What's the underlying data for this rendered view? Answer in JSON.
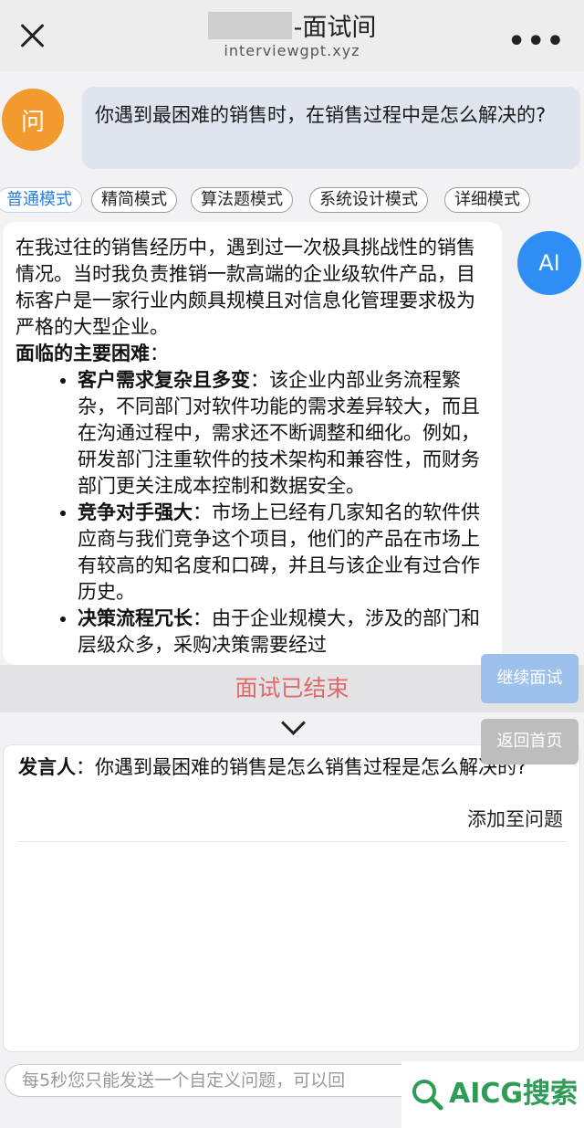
{
  "header": {
    "title": "-面试间",
    "url": "interviewgpt.xyz"
  },
  "question": {
    "avatar_label": "问",
    "text": "你遇到最困难的销售时，在销售过程中是怎么解决的?"
  },
  "modes": [
    "普通模式",
    "精简模式",
    "算法题模式",
    "系统设计模式",
    "详细模式"
  ],
  "answer": {
    "avatar_label": "AI",
    "intro": "在我过往的销售经历中，遇到过一次极具挑战性的销售情况。当时我负责推销一款高端的企业级软件产品，目标客户是一家行业内颇具规模且对信息化管理要求极为严格的大型企业。",
    "heading": "面临的主要困难",
    "heading_colon": "：",
    "points": [
      {
        "title": "客户需求复杂且多变",
        "text": "：该企业内部业务流程繁杂，不同部门对软件功能的需求差异较大，而且在沟通过程中，需求还不断调整和细化。例如，研发部门注重软件的技术架构和兼容性，而财务部门更关注成本控制和数据安全。"
      },
      {
        "title": "竞争对手强大",
        "text": "：市场上已经有几家知名的软件供应商与我们竞争这个项目，他们的产品在市场上有较高的知名度和口碑，并且与该企业有过合作历史。"
      },
      {
        "title": "决策流程冗长",
        "text": "：由于企业规模大，涉及的部门和层级众多，采购决策需要经过"
      }
    ]
  },
  "status": {
    "ended_text": "面试已结束",
    "continue_label": "继续面试",
    "home_label": "返回首页"
  },
  "transcript": {
    "speaker_label": "发言人",
    "speaker_text": "：你遇到最困难的销售是怎么销售过程是怎么解决的?",
    "add_label": "添加至问题"
  },
  "input": {
    "placeholder": "每5秒您只能发送一个自定义问题，可以回"
  },
  "watermark": {
    "text": "AICG搜索"
  },
  "colors": {
    "accent": "#2f8ef5",
    "question_avatar": "#f39a2e",
    "ended_text": "#e06a6a",
    "watermark": "#2e9c56"
  }
}
